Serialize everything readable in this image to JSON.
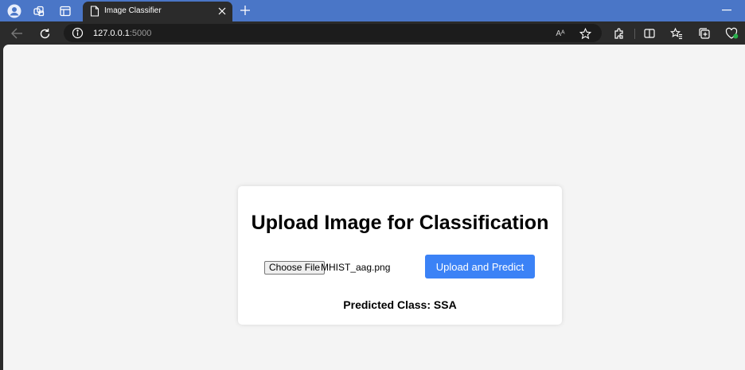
{
  "browser": {
    "tab": {
      "title": "Image Classifier"
    },
    "address": {
      "host": "127.0.0.1",
      "port": ":5000"
    },
    "read_aloud_glyph": "Aᴬ"
  },
  "page": {
    "heading": "Upload Image for Classification",
    "file_input": {
      "button_label": "Choose File",
      "file_name": "MHIST_aag.png"
    },
    "submit_label": "Upload and Predict",
    "result": "Predicted Class: SSA"
  },
  "colors": {
    "titlebar": "#4a76c7",
    "toolbar": "#2b2b2b",
    "page_bg": "#f4f4f4",
    "accent_button": "#3b82f6"
  },
  "icons": [
    "profile-icon",
    "workspaces-icon",
    "tab-actions-icon",
    "page-icon",
    "close-icon",
    "new-tab-icon",
    "minimize-icon",
    "back-icon",
    "refresh-icon",
    "info-icon",
    "read-aloud-icon",
    "favorite-star-icon",
    "extensions-icon",
    "split-screen-icon",
    "favorites-icon",
    "collections-icon",
    "browser-essentials-icon"
  ]
}
